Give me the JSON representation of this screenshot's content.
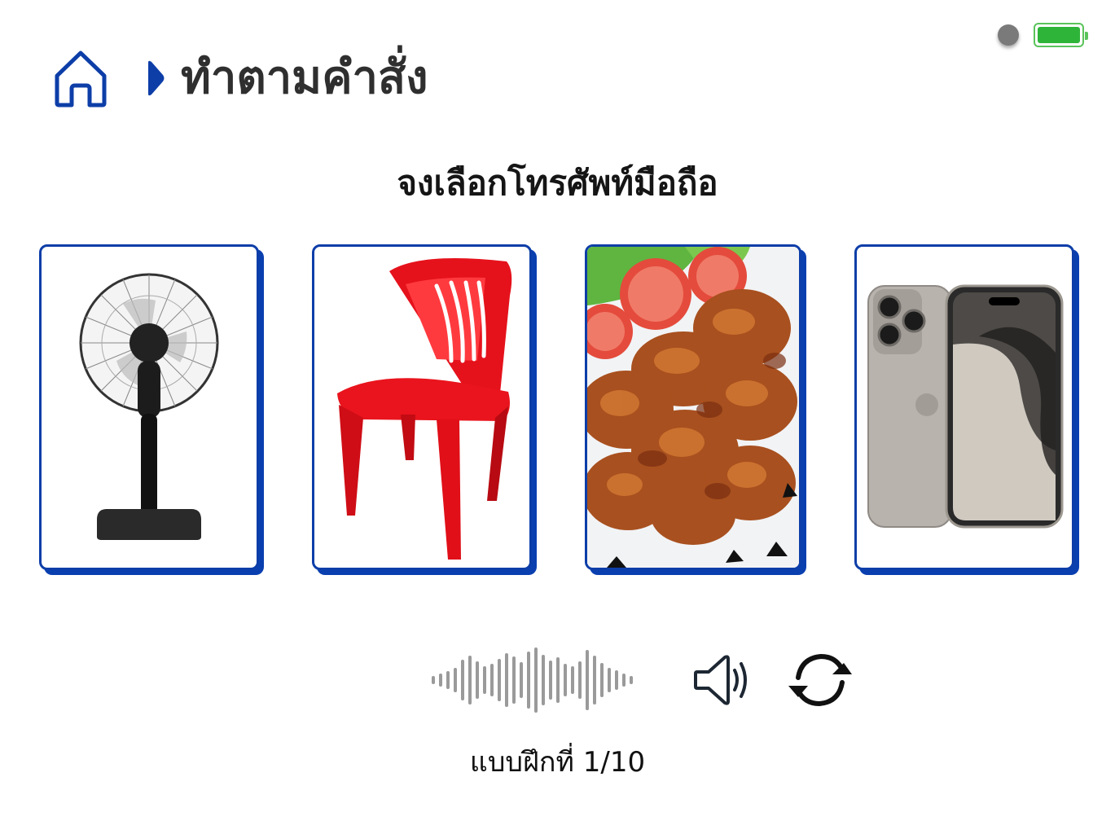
{
  "header": {
    "title": "ทำตามคำสั่ง",
    "home_icon": "home-icon",
    "chevron_icon": "chevron-right-icon"
  },
  "status": {
    "recording_icon": "record-dot-icon",
    "battery_icon": "battery-full-icon"
  },
  "instruction": "จงเลือกโทรศัพท์มือถือ",
  "choices": [
    {
      "id": "fan",
      "icon": "electric-fan-image"
    },
    {
      "id": "chair",
      "icon": "red-plastic-chair-image"
    },
    {
      "id": "chicken",
      "icon": "fried-chicken-wings-image"
    },
    {
      "id": "phone",
      "icon": "mobile-phone-image"
    }
  ],
  "audio": {
    "wave_icon": "audio-waveform-icon",
    "speaker_icon": "speaker-icon",
    "replay_icon": "replay-icon"
  },
  "progress_label": "แบบฝึกที่ 1/10",
  "colors": {
    "accent": "#0a3fb0",
    "battery": "#2fb43a",
    "title": "#2f2f2f"
  }
}
